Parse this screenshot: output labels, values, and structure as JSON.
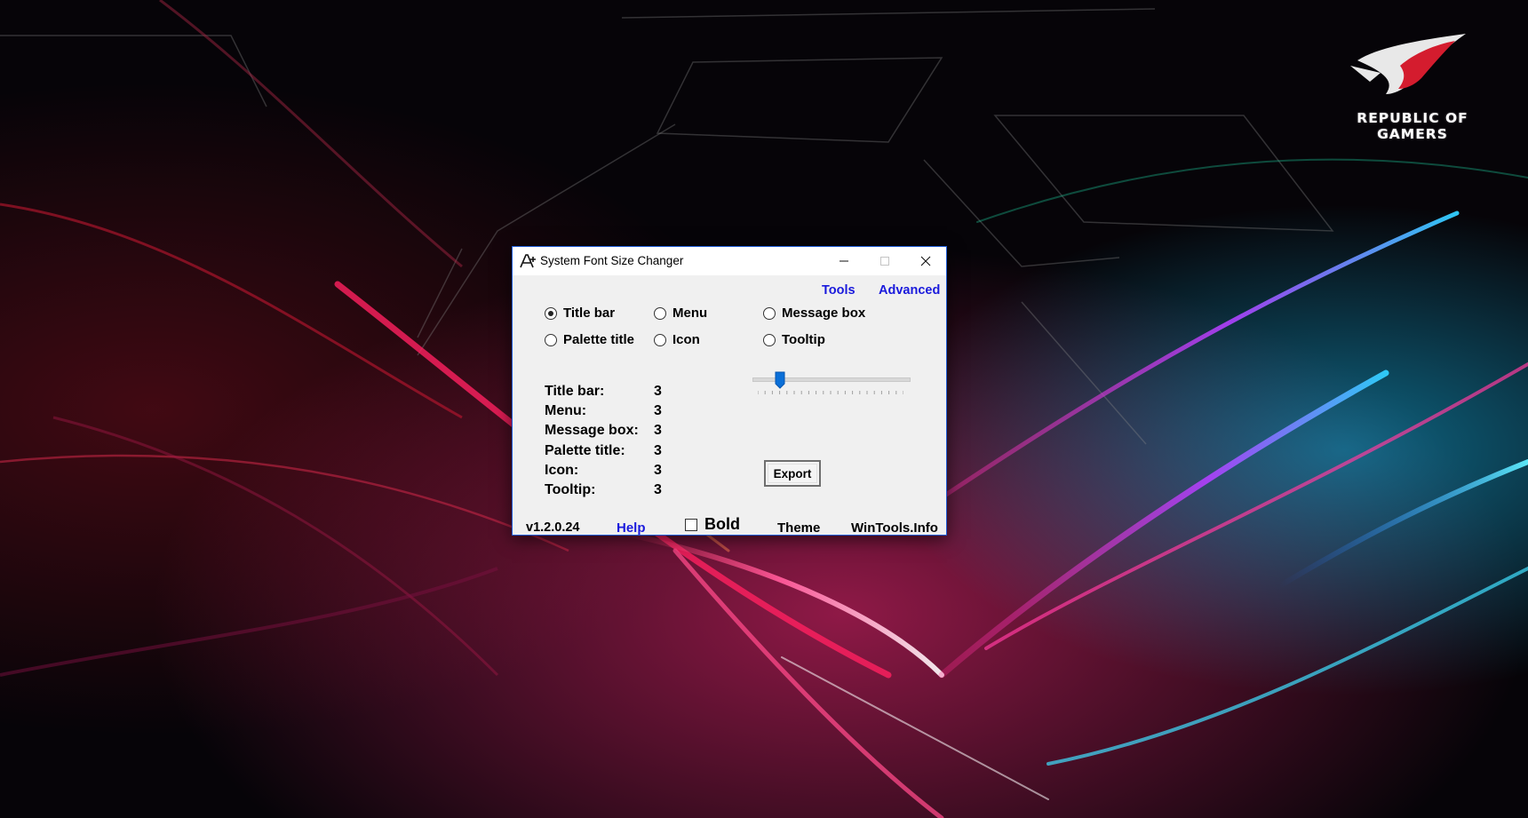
{
  "desktop": {
    "logo_line1": "REPUBLIC OF",
    "logo_line2": "GAMERS"
  },
  "window": {
    "title": "System Font Size Changer",
    "icon": "font-a-plus-icon",
    "accent_color": "#1e5bd6",
    "link_color": "#1a1adc"
  },
  "links": {
    "tools": "Tools",
    "advanced": "Advanced"
  },
  "radios": [
    {
      "label": "Title bar",
      "checked": true
    },
    {
      "label": "Menu",
      "checked": false
    },
    {
      "label": "Message box",
      "checked": false
    },
    {
      "label": "Palette title",
      "checked": false
    },
    {
      "label": "Icon",
      "checked": false
    },
    {
      "label": "Tooltip",
      "checked": false
    }
  ],
  "stats": [
    {
      "label": "Title bar:",
      "value": "3"
    },
    {
      "label": "Menu:",
      "value": "3"
    },
    {
      "label": "Message box:",
      "value": "3"
    },
    {
      "label": "Palette title:",
      "value": "3"
    },
    {
      "label": "Icon:",
      "value": "3"
    },
    {
      "label": "Tooltip:",
      "value": "3"
    }
  ],
  "slider": {
    "value": 3,
    "min": 0,
    "max": 20
  },
  "buttons": {
    "export": "Export"
  },
  "footer": {
    "version": "v1.2.0.24",
    "help": "Help",
    "bold_label": "Bold",
    "bold_checked": false,
    "theme": "Theme",
    "wintools": "WinTools.Info"
  }
}
